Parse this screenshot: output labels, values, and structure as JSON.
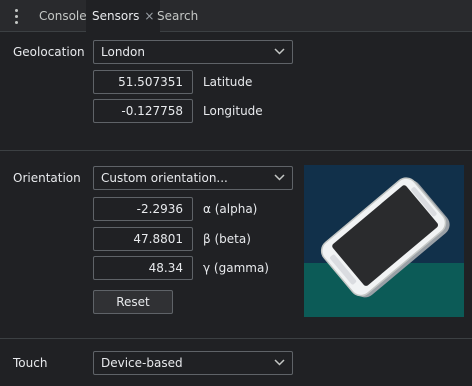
{
  "tabs": [
    {
      "label": "Console"
    },
    {
      "label": "Sensors",
      "close": "×"
    },
    {
      "label": "Search"
    }
  ],
  "geolocation": {
    "label": "Geolocation",
    "preset": "London",
    "latitude_value": "51.507351",
    "latitude_label": "Latitude",
    "longitude_value": "-0.127758",
    "longitude_label": "Longitude"
  },
  "orientation": {
    "label": "Orientation",
    "preset": "Custom orientation...",
    "alpha_value": "-2.2936",
    "alpha_label": "α (alpha)",
    "beta_value": "47.8801",
    "beta_label": "β (beta)",
    "gamma_value": "48.34",
    "gamma_label": "γ (gamma)",
    "reset_label": "Reset"
  },
  "touch": {
    "label": "Touch",
    "preset": "Device-based"
  },
  "colors": {
    "background": "#202124",
    "field_border": "#5f6368",
    "scene_sky": "#11304a",
    "scene_floor": "#0c5b57"
  },
  "icons": {
    "menu": "kebab-menu-icon",
    "dropdown": "chevron-down-icon"
  }
}
